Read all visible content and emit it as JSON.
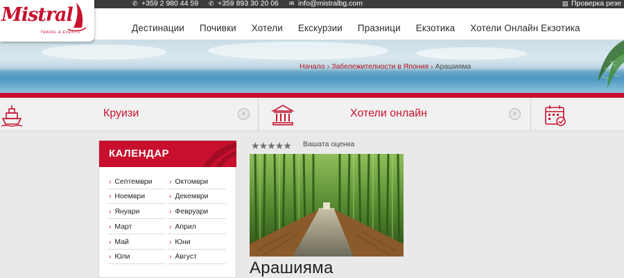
{
  "topbar": {
    "phone1": "+359 2 980 44 59",
    "phone2": "+359 893 30 20 06",
    "email": "info@mistralbg.com",
    "check_reservation": "Проверка резе"
  },
  "logo": {
    "name": "Mistral",
    "tagline": "TRAVEL & EVENTS"
  },
  "nav": {
    "items": [
      "Дестинации",
      "Почивки",
      "Хотели",
      "Екскурзии",
      "Празници",
      "Екзотика",
      "Хотели Онлайн Екзотика"
    ]
  },
  "breadcrumb": {
    "home": "Начало",
    "section": "Забележителности в Япония",
    "current": "Арашияма"
  },
  "categories": [
    {
      "label": "Круизи",
      "icon": "ship-icon"
    },
    {
      "label": "Хотели онлайн",
      "icon": "bank-building-icon"
    },
    {
      "label": "",
      "icon": "calendar-check-icon"
    }
  ],
  "calendar": {
    "title": "КАЛЕНДАР",
    "months": [
      "Септември",
      "Октомври",
      "Ноември",
      "Декември",
      "Януари",
      "Февруари",
      "Март",
      "Април",
      "Май",
      "Юни",
      "Юли",
      "Август"
    ]
  },
  "rating": {
    "stars": 5,
    "label": "Вашата оценка"
  },
  "page": {
    "title": "Арашияма"
  },
  "colors": {
    "brand_red": "#c8102e",
    "topbar": "#3b3b3b",
    "background": "#e9e9e9"
  }
}
